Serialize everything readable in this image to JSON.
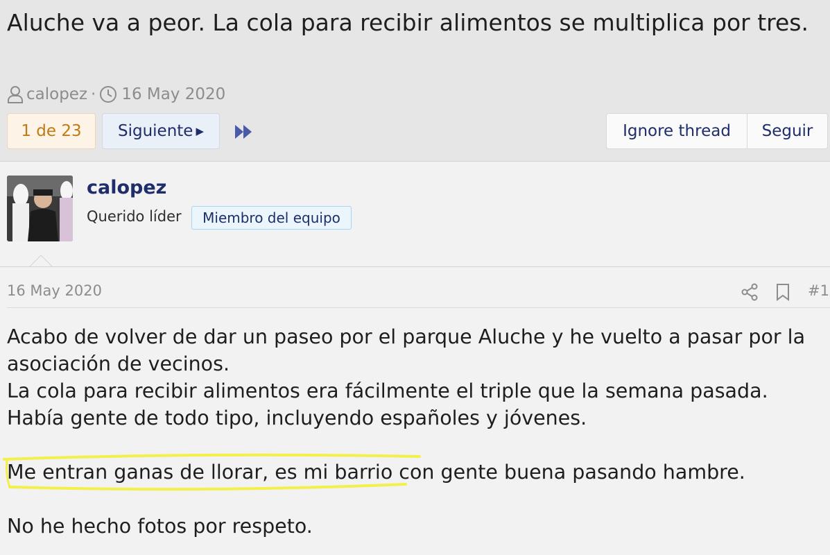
{
  "thread": {
    "title": "Aluche va a peor. La cola para recibir alimentos se multiplica por tres.",
    "author": "calopez",
    "separator": "·",
    "date": "16 May 2020"
  },
  "pagination": {
    "current": "1 de 23",
    "next_label": "Siguiente",
    "next_arrow": "▶"
  },
  "thread_actions": {
    "ignore_label": "Ignore thread",
    "follow_label": "Seguir"
  },
  "post": {
    "username": "calopez",
    "user_title": "Querido líder",
    "user_badge": "Miembro del equipo",
    "date": "16 May 2020",
    "number": "#1",
    "lines": [
      "Acabo de volver de dar un paseo por el parque Aluche y he vuelto a pasar por la asociación de vecinos.",
      "La cola para recibir alimentos era fácilmente el triple que la semana pasada.",
      "Había gente de todo tipo, incluyendo españoles y jóvenes.",
      "Me entran ganas de llorar, es mi barrio con gente buena pasando hambre.",
      "No he hecho fotos por respeto."
    ]
  },
  "icons": [
    "user-icon",
    "clock-icon",
    "fast-forward-icon",
    "share-icon",
    "bookmark-icon"
  ],
  "colors": {
    "link": "#1f2d6b",
    "page_current": "#c07a12",
    "muted": "#8c8c8c",
    "highlight": "#f3ef3a"
  }
}
